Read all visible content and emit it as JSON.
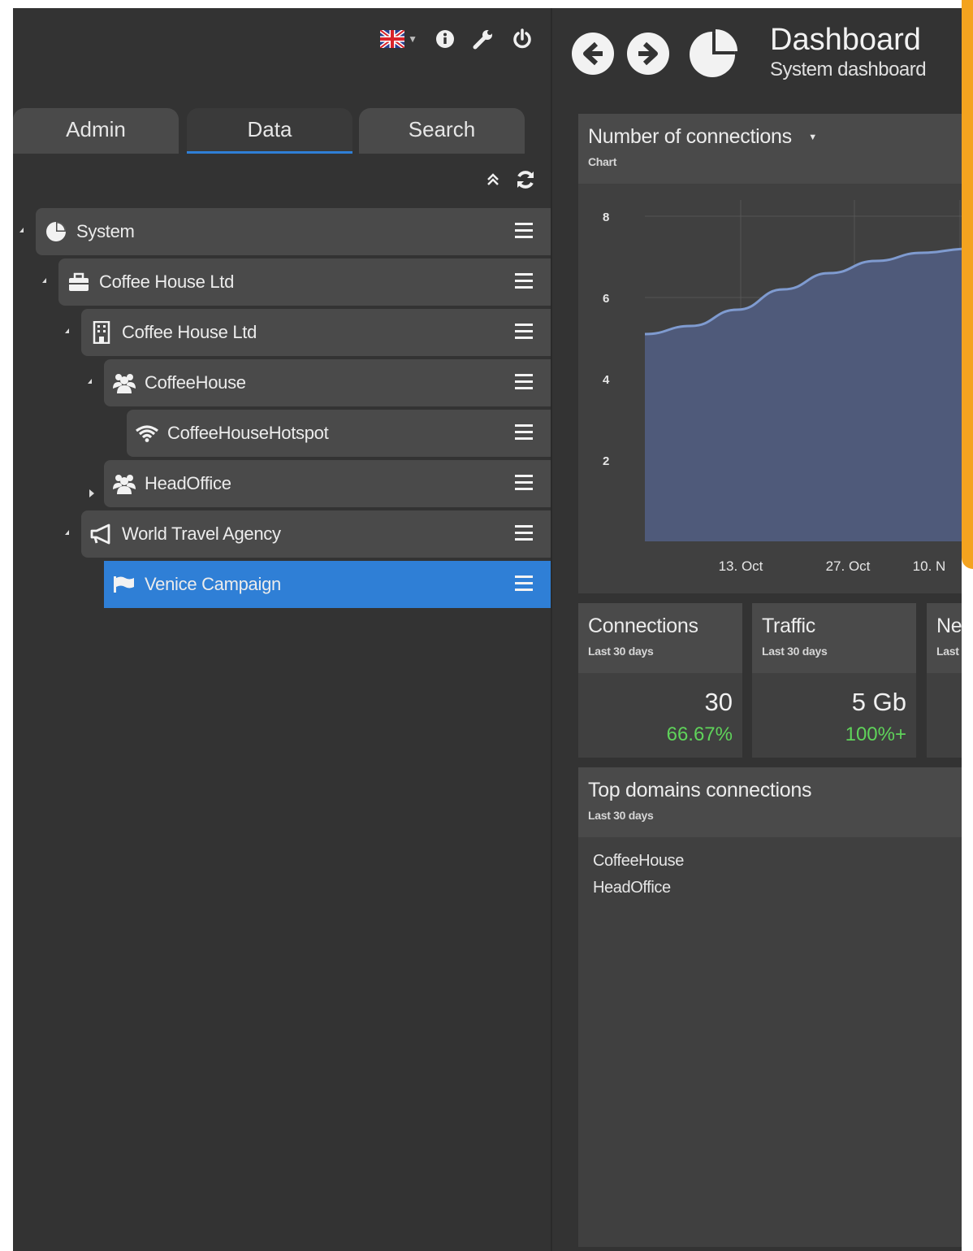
{
  "sidebar": {
    "tabs": [
      {
        "label": "Admin"
      },
      {
        "label": "Data"
      },
      {
        "label": "Search"
      }
    ],
    "active_tab": "Data",
    "tree": [
      {
        "label": "System",
        "icon": "pie-chart-icon",
        "expanded": true
      },
      {
        "label": "Coffee House Ltd",
        "icon": "briefcase-icon",
        "expanded": true
      },
      {
        "label": "Coffee House Ltd",
        "icon": "building-icon",
        "expanded": true
      },
      {
        "label": "CoffeeHouse",
        "icon": "users-icon",
        "expanded": true
      },
      {
        "label": "CoffeeHouseHotspot",
        "icon": "wifi-icon",
        "expanded": null
      },
      {
        "label": "HeadOffice",
        "icon": "users-icon",
        "expanded": false
      },
      {
        "label": "World Travel Agency",
        "icon": "megaphone-icon",
        "expanded": true
      },
      {
        "label": "Venice Campaign",
        "icon": "flag-icon",
        "expanded": null,
        "selected": true
      }
    ]
  },
  "header": {
    "title": "Dashboard",
    "subtitle": "System dashboard"
  },
  "chart_panel": {
    "title": "Number of connections",
    "subtitle": "Chart"
  },
  "chart_data": {
    "type": "area",
    "title": "Number of connections",
    "y_ticks": [
      "8",
      "6",
      "4",
      "2"
    ],
    "x_ticks": [
      "13. Oct",
      "27. Oct",
      "10. N"
    ],
    "ylim": [
      0,
      8
    ],
    "series": [
      {
        "values": [
          5.1,
          5.3,
          5.7,
          6.2,
          6.6,
          6.9,
          7.1,
          7.2
        ]
      }
    ],
    "grid": true,
    "color": "#4f5a7a",
    "line_color": "#7f9bd0"
  },
  "stats": [
    {
      "title": "Connections",
      "sub": "Last 30 days",
      "value": "30",
      "pct": "66.67%"
    },
    {
      "title": "Traffic",
      "sub": "Last 30 days",
      "value": "5 Gb",
      "pct": "100%+"
    },
    {
      "title": "Ne",
      "sub": "Last",
      "value": "",
      "pct": ""
    }
  ],
  "domains_panel": {
    "title": "Top domains connections",
    "subtitle": "Last 30 days",
    "items": [
      "CoffeeHouse",
      "HeadOffice"
    ]
  },
  "colors": {
    "accent": "#2f7fd6",
    "positive": "#5fd35a",
    "highlight": "#f4a31f"
  }
}
